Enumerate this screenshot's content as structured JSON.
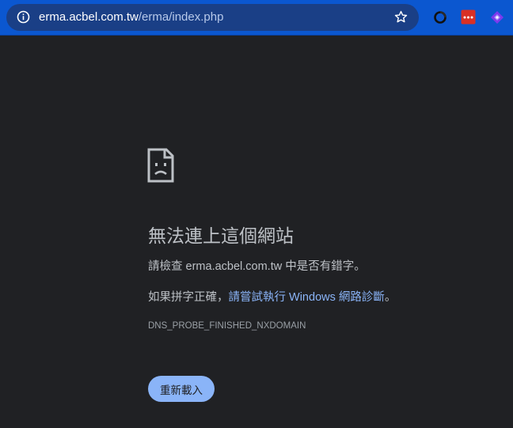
{
  "address_bar": {
    "url_host": "erma.acbel.com.tw",
    "url_path": "/erma/index.php"
  },
  "toolbar": {
    "icons": [
      "info-icon",
      "bookmark-star-icon",
      "extension-ring-icon",
      "extension-red-dots-icon",
      "extension-purple-diamond-icon"
    ]
  },
  "error": {
    "icon": "sad-document-icon",
    "title": "無法連上這個網站",
    "check_prefix": "請檢查 ",
    "check_host": "erma.acbel.com.tw",
    "check_suffix": " 中是否有錯字。",
    "spelling_prefix": "如果拼字正確，",
    "diagnostics_link": "請嘗試執行 Windows 網路診斷",
    "spelling_suffix": "。",
    "error_code": "DNS_PROBE_FINISHED_NXDOMAIN",
    "reload_label": "重新載入"
  },
  "colors": {
    "toolbar_bg": "#0b57d0",
    "page_bg": "#202124",
    "text": "#bdc1c6",
    "link": "#8ab4f8",
    "button_bg": "#8ab4f8"
  }
}
